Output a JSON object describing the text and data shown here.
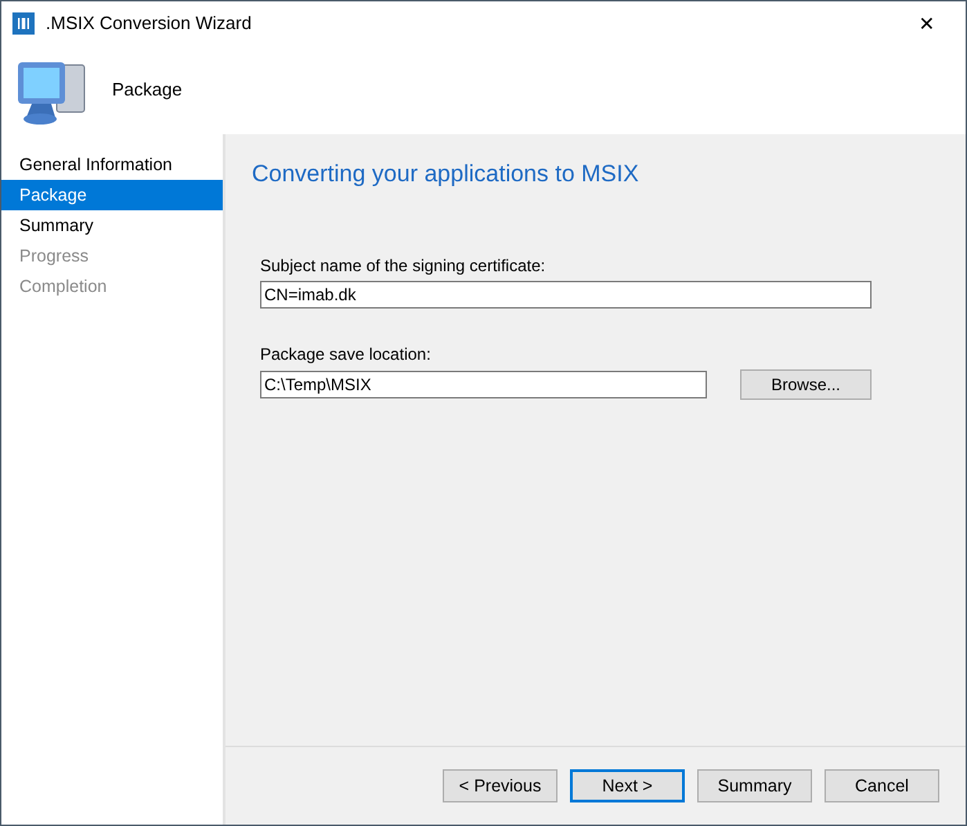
{
  "window": {
    "title": ".MSIX Conversion Wizard",
    "close": "✕"
  },
  "header": {
    "title": "Package"
  },
  "sidebar": {
    "items": [
      {
        "label": "General Information",
        "selected": false,
        "disabled": false
      },
      {
        "label": "Package",
        "selected": true,
        "disabled": false
      },
      {
        "label": "Summary",
        "selected": false,
        "disabled": false
      },
      {
        "label": "Progress",
        "selected": false,
        "disabled": true
      },
      {
        "label": "Completion",
        "selected": false,
        "disabled": true
      }
    ]
  },
  "content": {
    "heading": "Converting your applications to MSIX",
    "fields": [
      {
        "label": "Subject name of the signing certificate:",
        "value": "CN=imab.dk"
      },
      {
        "label": "Package save location:",
        "value": "C:\\Temp\\MSIX",
        "button": "Browse..."
      }
    ]
  },
  "buttons": [
    {
      "label": "< Previous",
      "default": false
    },
    {
      "label": "Next >",
      "default": true
    },
    {
      "label": "Summary",
      "default": false
    },
    {
      "label": "Cancel",
      "default": false
    }
  ]
}
